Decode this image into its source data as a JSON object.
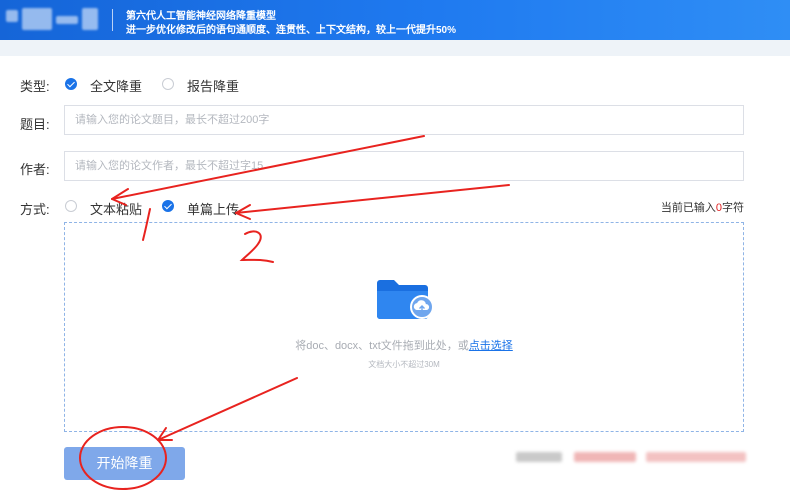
{
  "banner": {
    "line1": "第六代人工智能神经网络降重模型",
    "line2": "进一步优化修改后的语句通顺度、连贯性、上下文结构，较上一代提升50%"
  },
  "form": {
    "type_label": "类型:",
    "type_options": [
      "全文降重",
      "报告降重"
    ],
    "type_selected": "全文降重",
    "title_label": "题目:",
    "title_placeholder": "请输入您的论文题目，最长不超过200字",
    "author_label": "作者:",
    "author_placeholder": "请输入您的论文作者，最长不超过字15",
    "mode_label": "方式:",
    "mode_options": [
      "文本粘贴",
      "单篇上传"
    ],
    "mode_selected": "单篇上传",
    "counter_prefix": "当前已输入",
    "counter_value": "0",
    "counter_suffix": "字符"
  },
  "upload": {
    "hint_prefix": "将doc、docx、txt文件拖到此处，或",
    "hint_link": "点击选择",
    "size_note": "文档大小不超过30M",
    "icon": "folder-cloud-upload-icon"
  },
  "actions": {
    "start_label": "开始降重"
  },
  "annotations": {
    "mark_1": "1",
    "mark_2": "2",
    "color": "#e8231f"
  },
  "colors": {
    "accent": "#1a73e8",
    "banner": "#1a6fe0",
    "button": "#7fa8ea"
  }
}
